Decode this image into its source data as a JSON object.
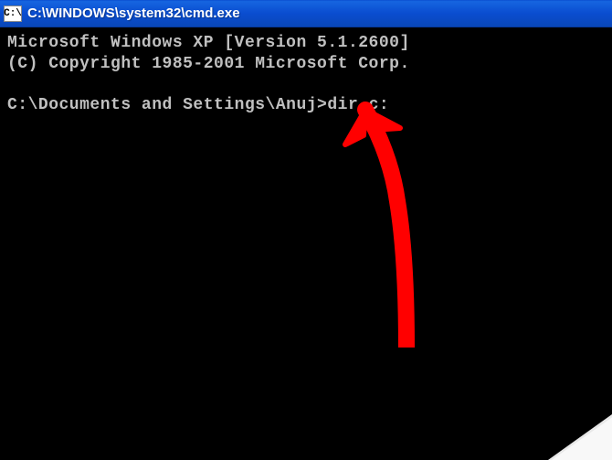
{
  "titlebar": {
    "icon_label": "C:\\",
    "title": "C:\\WINDOWS\\system32\\cmd.exe"
  },
  "terminal": {
    "line1": "Microsoft Windows XP [Version 5.1.2600]",
    "line2": "(C) Copyright 1985-2001 Microsoft Corp.",
    "blank": " ",
    "prompt": "C:\\Documents and Settings\\Anuj>",
    "command": "dir c:"
  },
  "annotation": {
    "arrow_color": "#ff0000"
  }
}
